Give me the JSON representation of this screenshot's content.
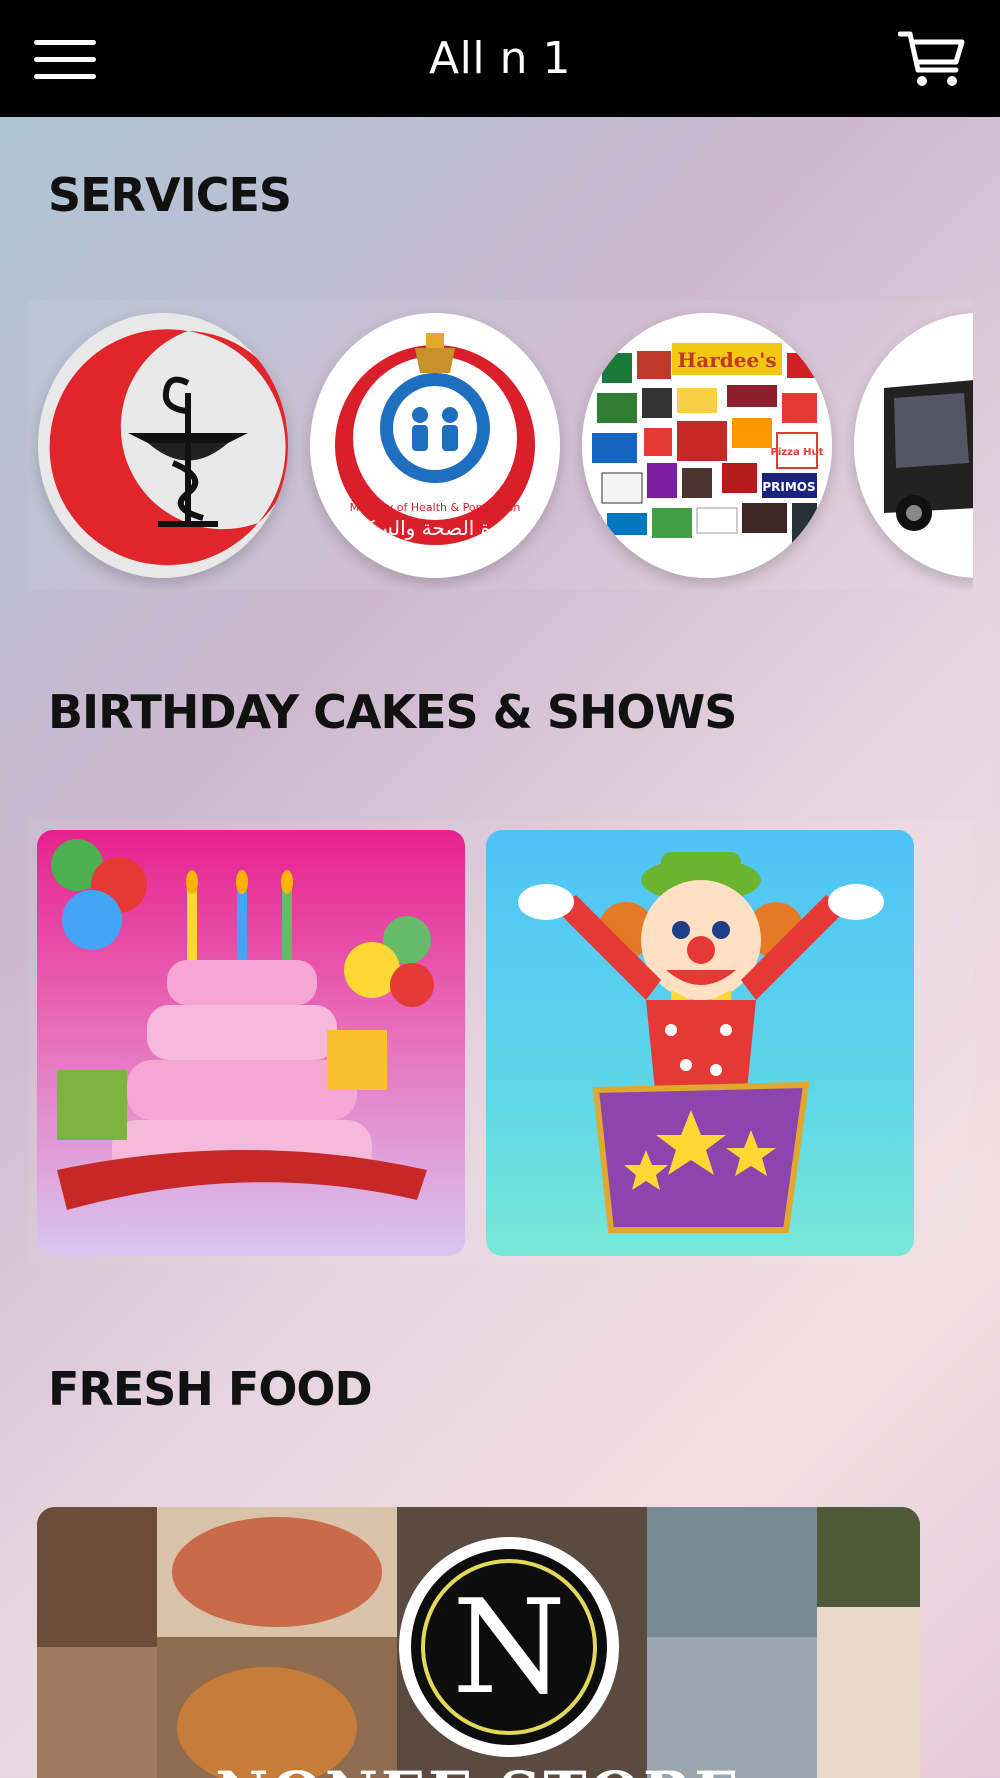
{
  "header": {
    "title": "All n 1",
    "menu_icon": "hamburger-menu-icon",
    "cart_icon": "cart-icon"
  },
  "sections": {
    "services": {
      "title": "SERVICES",
      "items": [
        {
          "name": "pharmacy",
          "icon": "pharmacy-logo"
        },
        {
          "name": "ministry-of-health",
          "icon": "ministry-health-logo",
          "caption_en": "Ministry of Health & Population",
          "caption_ar": "وزارة الصحة والسكان"
        },
        {
          "name": "restaurants",
          "icon": "restaurants-collage",
          "brands": [
            "Hardee's",
            "Pizza Hut",
            "PRIMOS"
          ]
        },
        {
          "name": "transport",
          "icon": "bus-image"
        }
      ]
    },
    "birthday": {
      "title": "BIRTHDAY CAKES & SHOWS",
      "items": [
        {
          "name": "birthday-cake",
          "icon": "cake-image"
        },
        {
          "name": "clown-show",
          "icon": "clown-image"
        }
      ]
    },
    "fresh_food": {
      "title": "FRESH FOOD",
      "items": [
        {
          "name": "nonee-store",
          "logo_letter": "N",
          "label": "NONEE STORE"
        }
      ]
    }
  },
  "colors": {
    "topbar": "#000000",
    "title_text": "#111111",
    "header_text": "#ffffff"
  }
}
